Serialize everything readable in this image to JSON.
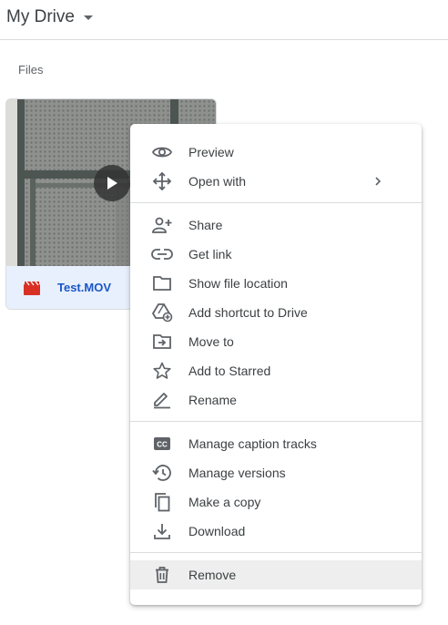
{
  "header": {
    "title": "My Drive"
  },
  "section": {
    "label": "Files"
  },
  "file": {
    "name": "Test.MOV",
    "type_icon": "video-file-icon",
    "thumbnail": "video-thumbnail"
  },
  "context_menu": {
    "groups": [
      [
        {
          "label": "Preview",
          "icon": "eye-icon"
        },
        {
          "label": "Open with",
          "icon": "move-arrows-icon",
          "submenu": true
        }
      ],
      [
        {
          "label": "Share",
          "icon": "add-person-icon"
        },
        {
          "label": "Get link",
          "icon": "link-icon"
        },
        {
          "label": "Show file location",
          "icon": "folder-icon"
        },
        {
          "label": "Add shortcut to Drive",
          "icon": "drive-shortcut-icon"
        },
        {
          "label": "Move to",
          "icon": "move-to-folder-icon"
        },
        {
          "label": "Add to Starred",
          "icon": "star-icon"
        },
        {
          "label": "Rename",
          "icon": "pencil-icon"
        }
      ],
      [
        {
          "label": "Manage caption tracks",
          "icon": "closed-caption-icon"
        },
        {
          "label": "Manage versions",
          "icon": "history-icon"
        },
        {
          "label": "Make a copy",
          "icon": "copy-icon"
        },
        {
          "label": "Download",
          "icon": "download-icon"
        }
      ],
      [
        {
          "label": "Remove",
          "icon": "trash-icon",
          "highlighted": true
        }
      ]
    ]
  },
  "colors": {
    "accent": "#1a56c4",
    "selected_card": "#e8f0fe",
    "hover": "#eeeeee",
    "file_icon": "#d93025",
    "icon_gray": "#5f6368"
  }
}
